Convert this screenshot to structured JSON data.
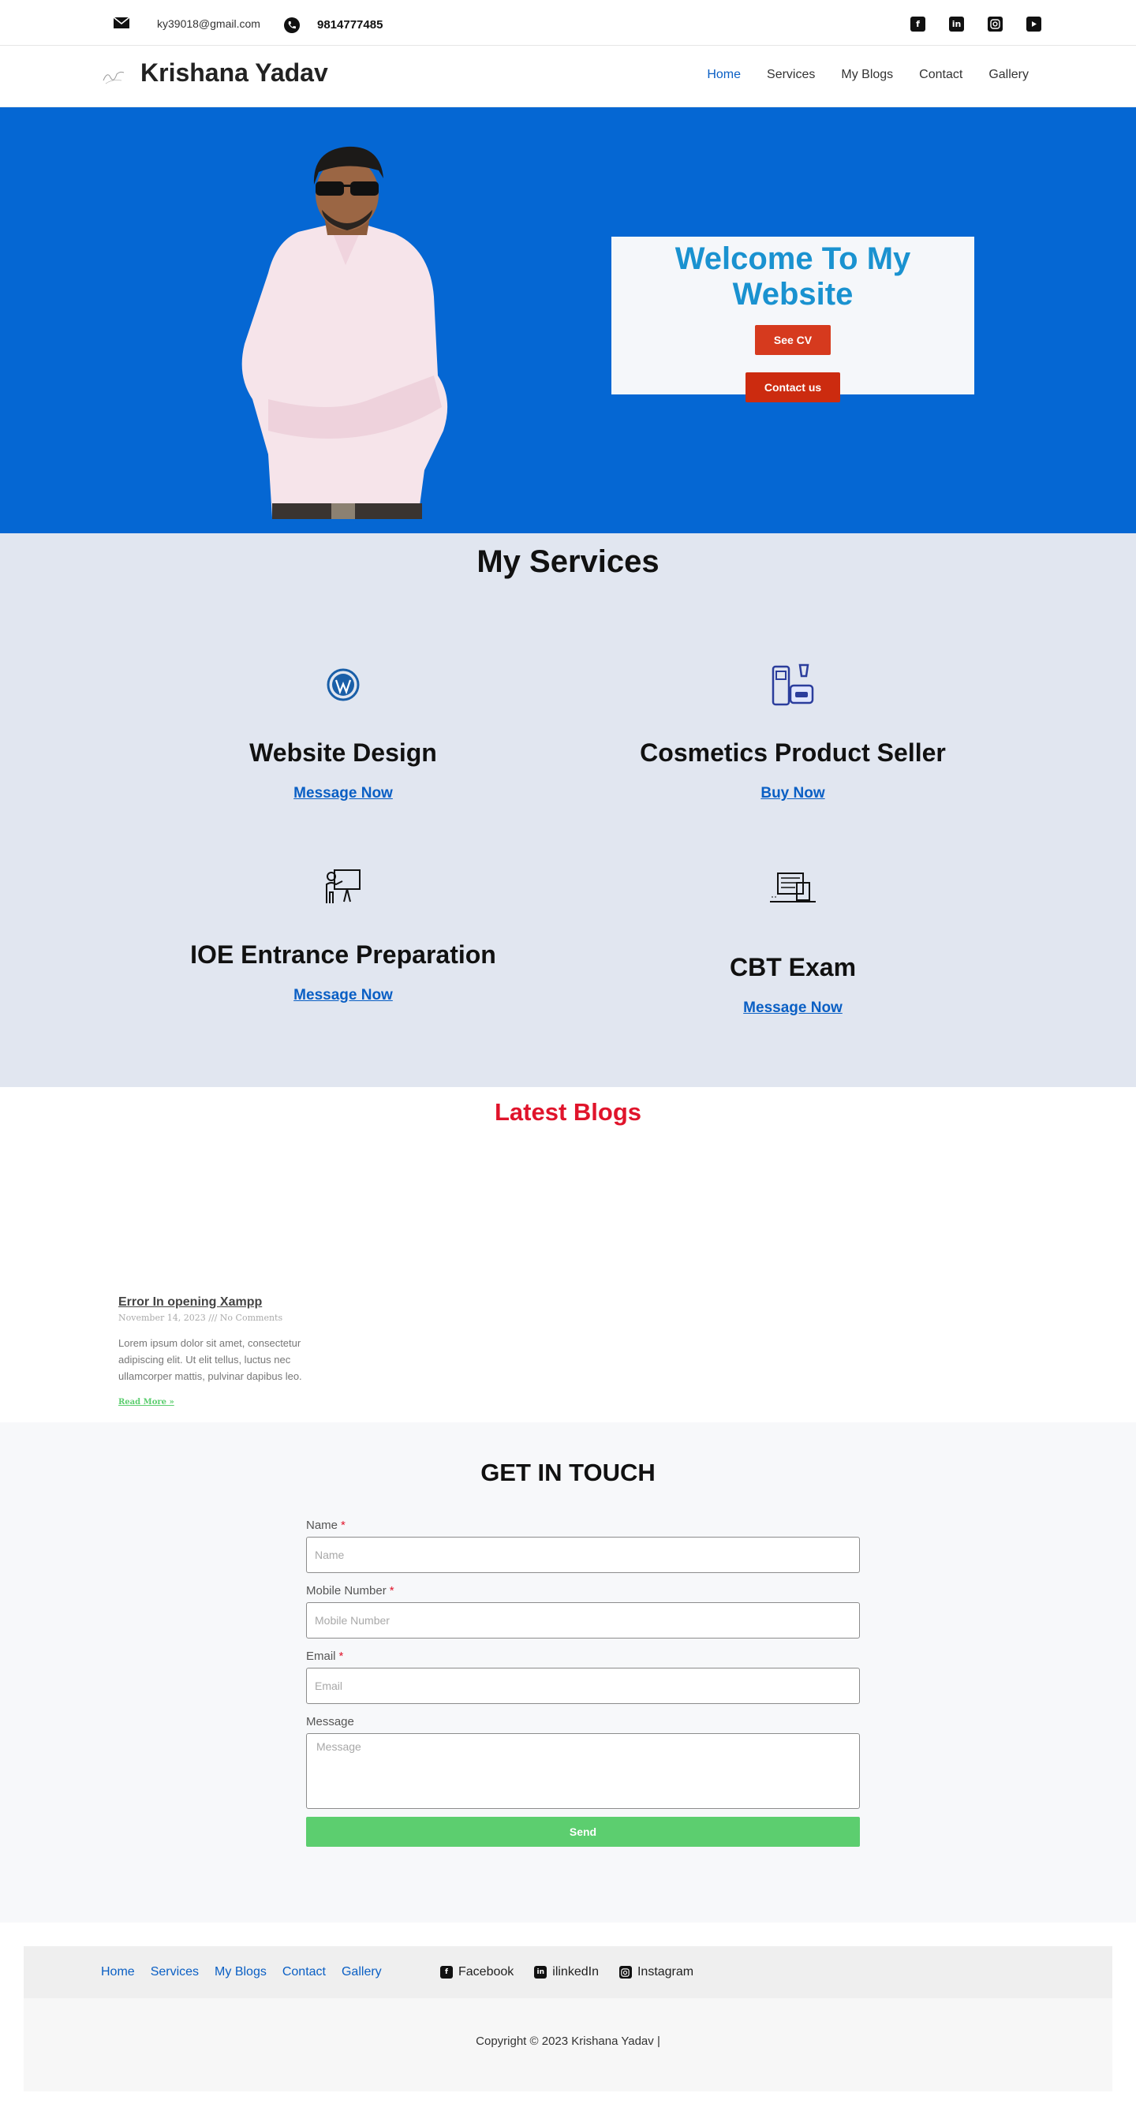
{
  "topbar": {
    "email": "ky39018@gmail.com",
    "phone": "9814777485",
    "socials": [
      "facebook-square-icon",
      "linkedin-icon",
      "instagram-icon",
      "youtube-icon"
    ]
  },
  "header": {
    "title": "Krishana Yadav",
    "nav": [
      "Home",
      "Services",
      "My Blogs",
      "Contact",
      "Gallery"
    ]
  },
  "hero": {
    "heading": "Welcome To My Website",
    "cv_button": "See CV",
    "contact_button": "Contact us",
    "bg_color": "#0567d3"
  },
  "services": {
    "heading": "My Services",
    "items": [
      {
        "title": "Website Design",
        "link": "Message Now",
        "icon": "wordpress-icon"
      },
      {
        "title": "Cosmetics Product Seller",
        "link": "Buy Now",
        "icon": "cosmetics-icon"
      },
      {
        "title": "IOE Entrance Preparation",
        "link": "Message Now",
        "icon": "teacher-board-icon"
      },
      {
        "title": "CBT Exam",
        "link": "Message Now",
        "icon": "computer-exam-icon"
      }
    ]
  },
  "blogs": {
    "heading": "Latest Blogs",
    "post": {
      "title": "Error In opening Xampp",
      "meta": "November 14, 2023 /// No Comments",
      "excerpt": "Lorem ipsum dolor sit amet, consectetur adipiscing elit. Ut elit tellus, luctus nec ullamcorper mattis, pulvinar dapibus leo.",
      "more": "Read More »"
    }
  },
  "contact": {
    "heading": "GET IN TOUCH",
    "name_label": "Name",
    "name_placeholder": "Name",
    "mobile_label": "Mobile Number",
    "mobile_placeholder": "Mobile Number",
    "email_label": "Email",
    "email_placeholder": "Email",
    "message_label": "Message",
    "message_placeholder": "Message",
    "required_mark": "*",
    "send": "Send"
  },
  "footer": {
    "nav": [
      "Home",
      "Services",
      "My Blogs",
      "Contact",
      "Gallery"
    ],
    "socials": [
      "Facebook",
      "ilinkedIn",
      "Instagram"
    ],
    "copyright": "Copyright © 2023 Krishana Yadav |"
  }
}
